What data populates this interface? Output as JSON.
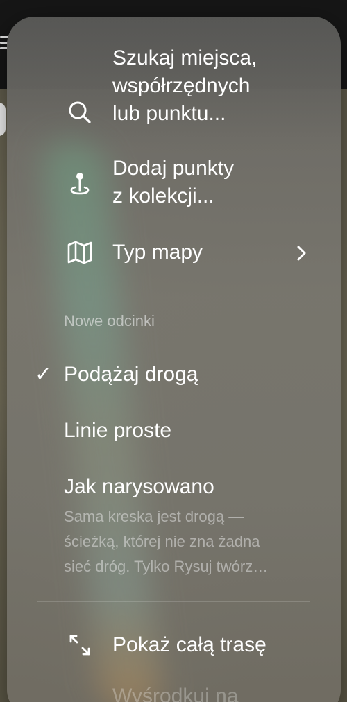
{
  "menu": {
    "search_line1": "Szukaj miejsca,",
    "search_line2": "współrzędnych",
    "search_line3": "lub punktu...",
    "add_points_line1": "Dodaj punkty",
    "add_points_line2": "z kolekcji...",
    "map_type_label": "Typ mapy",
    "section_title": "Nowe odcinki",
    "follow_road_label": "Podążaj drogą",
    "follow_road_check": "✓",
    "straight_lines_label": "Linie proste",
    "as_drawn_label": "Jak narysowano",
    "as_drawn_desc_line1": "Sama kreska jest drogą —",
    "as_drawn_desc_line2": "ścieżką, której nie zna żadna",
    "as_drawn_desc_line3": "sieć dróg. Tylko Rysuj twórz…",
    "show_route_label": "Pokaż całą trasę",
    "center_partial_label": "Wyśrodkuj na"
  },
  "icons": {
    "search": "search-icon",
    "add_points": "map-pin-icon",
    "map_type": "map-icon",
    "chevron": "chevron-right-icon",
    "check": "checkmark-icon",
    "expand": "expand-arrows-icon"
  },
  "colors": {
    "text_primary": "#ffffff",
    "text_secondary": "#bdbdbd",
    "popover_bg": "#727068"
  }
}
